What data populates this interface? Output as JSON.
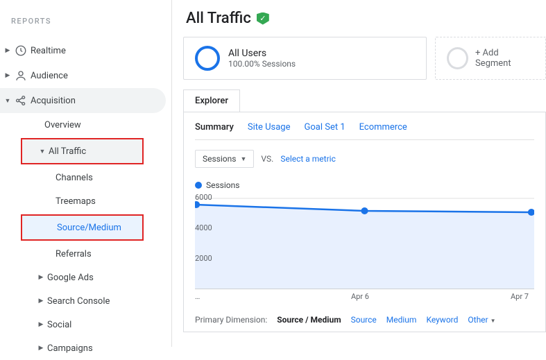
{
  "sidebar": {
    "heading": "REPORTS",
    "realtime": "Realtime",
    "audience": "Audience",
    "acquisition": "Acquisition",
    "overview": "Overview",
    "all_traffic": "All Traffic",
    "channels": "Channels",
    "treemaps": "Treemaps",
    "source_medium": "Source/Medium",
    "referrals": "Referrals",
    "google_ads": "Google Ads",
    "search_console": "Search Console",
    "social": "Social",
    "campaigns": "Campaigns"
  },
  "header": {
    "title": "All Traffic"
  },
  "segments": {
    "all_users_title": "All Users",
    "all_users_sub": "100.00% Sessions",
    "add_label": "+ Add Segment"
  },
  "explorer": {
    "tab": "Explorer",
    "summary": "Summary",
    "site_usage": "Site Usage",
    "goal_set": "Goal Set 1",
    "ecommerce": "Ecommerce",
    "metric_select": "Sessions",
    "vs": "VS.",
    "select_metric": "Select a metric",
    "legend": "Sessions"
  },
  "chart_data": {
    "type": "line",
    "title": "",
    "xlabel": "",
    "ylabel": "",
    "ylim": [
      0,
      6000
    ],
    "yticks": [
      2000,
      4000,
      6000
    ],
    "categories": [
      "…",
      "Apr 6",
      "Apr 7"
    ],
    "series": [
      {
        "name": "Sessions",
        "values": [
          5600,
          5200,
          5100
        ]
      }
    ]
  },
  "primary_dimension": {
    "label": "Primary Dimension:",
    "active": "Source / Medium",
    "source": "Source",
    "medium": "Medium",
    "keyword": "Keyword",
    "other": "Other"
  }
}
